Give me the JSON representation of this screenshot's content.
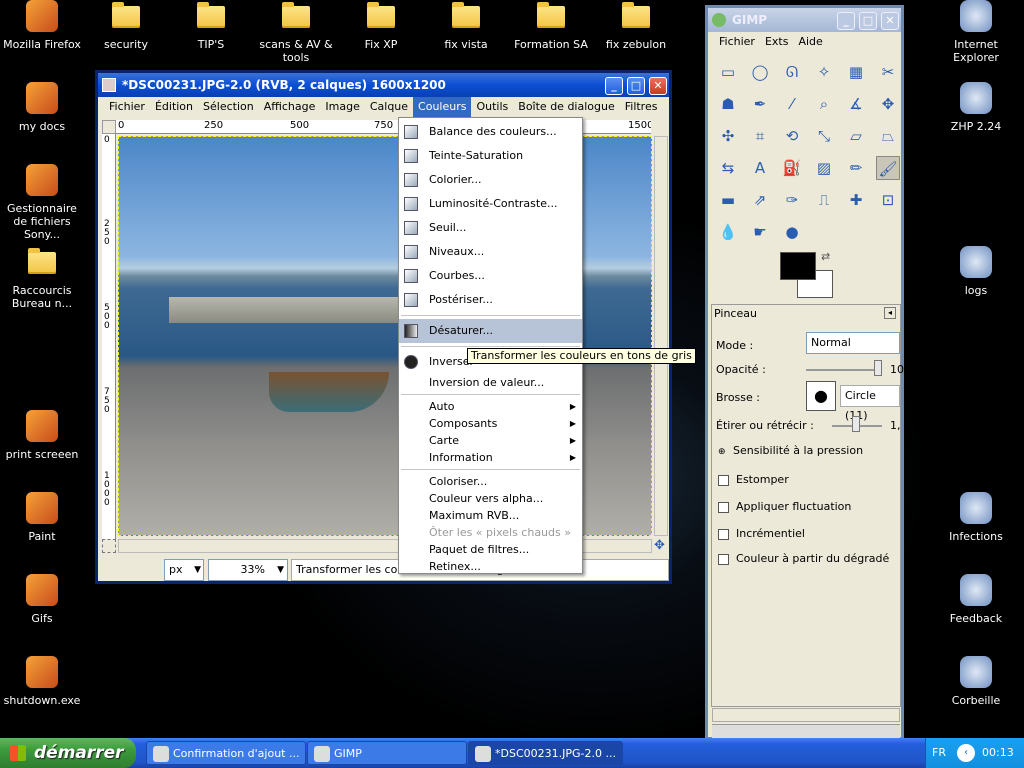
{
  "desktop_left": [
    {
      "label": "Mozilla Firefox",
      "icon": "firefox-icon"
    },
    {
      "label": "my docs",
      "icon": "my-docs-icon"
    },
    {
      "label": "Gestionnaire de fichiers Sony...",
      "icon": "sony-file-manager-icon"
    },
    {
      "label": "Raccourcis Bureau n...",
      "icon": "folder-icon"
    },
    {
      "label": "print screeen",
      "icon": "print-screen-icon"
    },
    {
      "label": "Paint",
      "icon": "paint-icon"
    },
    {
      "label": "Gifs",
      "icon": "document-icon"
    },
    {
      "label": "shutdown.exe",
      "icon": "shutdown-icon"
    }
  ],
  "desktop_top": [
    {
      "label": "security"
    },
    {
      "label": "TIP'S"
    },
    {
      "label": "scans & AV & tools"
    },
    {
      "label": "Fix XP"
    },
    {
      "label": "fix vista"
    },
    {
      "label": "Formation SA"
    },
    {
      "label": "fix zebulon"
    }
  ],
  "desktop_right": [
    {
      "label": "Internet Explorer",
      "icon": "internet-explorer-icon"
    },
    {
      "label": "ZHP 2.24",
      "icon": "zhp-icon"
    },
    {
      "label": "logs",
      "icon": "search-icon"
    },
    {
      "label": "Infections",
      "icon": "no-entry-icon"
    },
    {
      "label": "Feedback",
      "icon": "document-icon"
    },
    {
      "label": "Corbeille",
      "icon": "recycle-bin-icon"
    }
  ],
  "image_window": {
    "title": "*DSC00231.JPG-2.0 (RVB, 2 calques) 1600x1200",
    "menus": [
      "Fichier",
      "Édition",
      "Sélection",
      "Affichage",
      "Image",
      "Calque",
      "Couleurs",
      "Outils",
      "Boîte de dialogue",
      "Filtres"
    ],
    "ruler_h": [
      "0",
      "250",
      "500",
      "750",
      "1500"
    ],
    "ruler_v": [
      "0",
      "2\n5\n0",
      "5\n0\n0",
      "7\n5\n0",
      "1\n0\n0\n0"
    ],
    "unit": "px",
    "zoom": "33%",
    "status": "Transformer les couleurs en tons de gris"
  },
  "couleurs_menu": {
    "items": [
      {
        "label": "Balance des couleurs...",
        "icon": "color-balance-icon"
      },
      {
        "label": "Teinte-Saturation",
        "icon": "hue-saturation-icon"
      },
      {
        "label": "Colorier...",
        "icon": "colorize-icon"
      },
      {
        "label": "Luminosité-Contraste...",
        "icon": "brightness-contrast-icon"
      },
      {
        "label": "Seuil...",
        "icon": "threshold-icon"
      },
      {
        "label": "Niveaux...",
        "icon": "levels-icon"
      },
      {
        "label": "Courbes...",
        "icon": "curves-icon"
      },
      {
        "label": "Postériser...",
        "icon": "posterize-icon"
      }
    ],
    "desaturate": "Désaturer...",
    "invert": "Inverser",
    "value_invert": "Inversion de valeur...",
    "submenus": [
      "Auto",
      "Composants",
      "Carte",
      "Information"
    ],
    "extra": [
      "Coloriser...",
      "Couleur vers alpha...",
      "Maximum RVB...",
      "Ôter les « pixels chauds » ...",
      "Paquet de filtres...",
      "Retinex..."
    ],
    "tooltip": "Transformer les couleurs en tons de gris"
  },
  "gimp_toolbox": {
    "title": "GIMP",
    "menus": [
      "Fichier",
      "Exts",
      "Aide"
    ],
    "options_title": "Pinceau",
    "mode_label": "Mode :",
    "mode_value": "Normal",
    "opacity_label": "Opacité :",
    "opacity_value": "10",
    "brush_label": "Brosse :",
    "brush_value": "Circle (11)",
    "scale_label": "Étirer ou rétrécir :",
    "scale_value": "1,",
    "pressure_label": "Sensibilité à la pression",
    "checks": [
      "Estomper",
      "Appliquer fluctuation",
      "Incrémentiel",
      "Couleur à partir du dégradé"
    ]
  },
  "taskbar": {
    "start": "démarrer",
    "tasks": [
      "Confirmation d'ajout ...",
      "GIMP",
      "*DSC00231.JPG-2.0 ..."
    ],
    "lang": "FR",
    "time": "00:13"
  },
  "colors": {
    "taskbar": "#245edb",
    "start": "#3c9a3c",
    "title": "#0b4fd5"
  }
}
